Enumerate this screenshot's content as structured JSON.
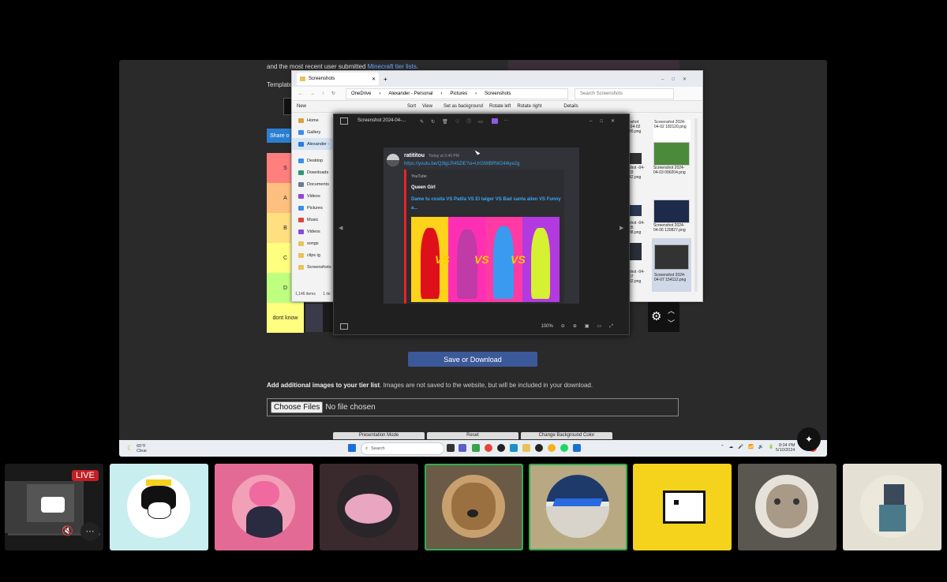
{
  "shared_screen": {
    "web_text": {
      "recent_line_prefix": "and the most recent user submitted ",
      "recent_line_link": "Minecraft tier lists",
      "recent_line_suffix": ".",
      "template_label": "Template",
      "share_label": "Share o"
    },
    "tiers": [
      {
        "label": "S",
        "color": "#ff7f7f"
      },
      {
        "label": "A",
        "color": "#ffbf7f"
      },
      {
        "label": "B",
        "color": "#ffdf7f"
      },
      {
        "label": "C",
        "color": "#ffff7f"
      },
      {
        "label": "D",
        "color": "#bfff7f"
      },
      {
        "label": "dont know",
        "color": "#ffff7f"
      }
    ],
    "save_download_label": "Save or Download",
    "add_images_bold": "Add additional images to your tier list",
    "add_images_rest": ". Images are not saved to the website, but will be included in your download.",
    "choose_files_label": "Choose Files",
    "no_file_text": "No file chosen",
    "bottom_buttons": [
      "Presentation Mode",
      "Reset",
      "Change Background Color"
    ],
    "explorer": {
      "tab_title": "Screenshots",
      "breadcrumb": [
        "OneDrive",
        "Alexander - Personal",
        "Pictures",
        "Screenshots"
      ],
      "search_placeholder": "Search Screenshots",
      "commands": [
        "New",
        "Sort",
        "View",
        "Set as background",
        "Rotate left",
        "Rotate right",
        "Details"
      ],
      "sidebar": [
        {
          "label": "Home",
          "icon": "home-icon",
          "color": "#d9a23b"
        },
        {
          "label": "Gallery",
          "icon": "gallery-icon",
          "color": "#3a8ee6"
        },
        {
          "label": "Alexander -",
          "icon": "cloud-icon",
          "color": "#2b7cd3"
        },
        {
          "label": "Desktop",
          "icon": "desktop-icon",
          "color": "#3a8ee6"
        },
        {
          "label": "Downloads",
          "icon": "download-icon",
          "color": "#2b9a6e"
        },
        {
          "label": "Documents",
          "icon": "document-icon",
          "color": "#6b7a8f"
        },
        {
          "label": "Videos",
          "icon": "video-icon",
          "color": "#8a4ad9"
        },
        {
          "label": "Pictures",
          "icon": "picture-icon",
          "color": "#3a8ee6"
        },
        {
          "label": "Music",
          "icon": "music-icon",
          "color": "#d9483b"
        },
        {
          "label": "Videos",
          "icon": "video-icon",
          "color": "#8a4ad9"
        },
        {
          "label": "songs",
          "icon": "folder-icon",
          "color": "#e8c25a"
        },
        {
          "label": "clips ig",
          "icon": "folder-icon",
          "color": "#e8c25a"
        },
        {
          "label": "Screenshots",
          "icon": "folder-icon",
          "color": "#e8c25a"
        }
      ],
      "status_items": "1,146 items",
      "status_selected": "1 ite",
      "files": [
        {
          "name": "Screenshot 2024-04-02 182120.png"
        },
        {
          "name": "Screenshot 2024-04-03 090204.png"
        },
        {
          "name": "Screenshot 2024-04-06 120827.png"
        },
        {
          "name": "Screenshot 2024-04-07 154112.png"
        }
      ],
      "partial_files": [
        {
          "name": "nshot -04-02 45.png"
        },
        {
          "name": "shot -04-03 42.png"
        },
        {
          "name": "shot -04-05 38.png"
        },
        {
          "name": "shot -04-07 32.png"
        }
      ]
    },
    "viewer": {
      "title": "Screenshot 2024-04-...",
      "zoom": "100%",
      "discord": {
        "username": "ratititou",
        "timestamp": "Today at 3:40 PM",
        "link": "https://youtu.be/Q3lgLR49ZlE?si=UrGlWBRW244tye2g",
        "provider": "YouTube",
        "channel": "Queen Girl",
        "video_title": "Dame tu cosita VS Patila VS El taiger VS Bad santa alien VS Funny a..."
      }
    },
    "taskbar": {
      "weather_temp": "65°F",
      "weather_desc": "Clear",
      "search_placeholder": "Search",
      "time": "8:04 PM",
      "date": "5/10/2024"
    }
  },
  "participants": {
    "live_badge": "LIVE",
    "tiles": [
      {
        "name": "screen-share-tile",
        "bg": "#1a1a1a"
      },
      {
        "name": "participant-tile-1",
        "bg": "#c8eef0"
      },
      {
        "name": "participant-tile-2",
        "bg": "#e46a96"
      },
      {
        "name": "participant-tile-3",
        "bg": "#3a2a2e"
      },
      {
        "name": "participant-tile-4",
        "bg": "#6a5a46"
      },
      {
        "name": "participant-tile-5",
        "bg": "#b9a982"
      },
      {
        "name": "participant-tile-6",
        "bg": "#f5d21c"
      },
      {
        "name": "participant-tile-7",
        "bg": "#5a5650"
      },
      {
        "name": "participant-tile-8",
        "bg": "#e4e0d4"
      }
    ]
  }
}
